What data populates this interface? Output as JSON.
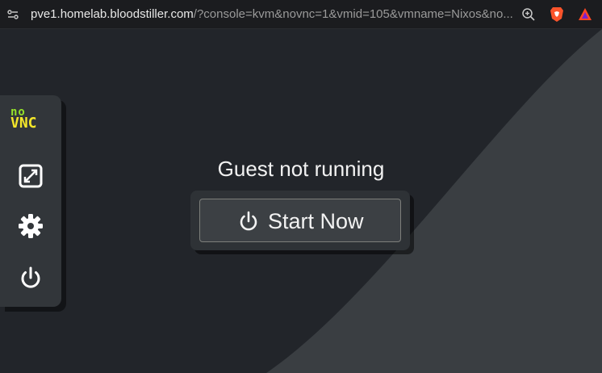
{
  "browser": {
    "url_host": "pve1.homelab.bloodstiller.com",
    "url_rest": "/?console=kvm&novnc=1&vmid=105&vmname=Nixos&no...",
    "icons": [
      "site-info-icon",
      "zoom-icon",
      "brave-shields-icon",
      "brave-rewards-icon"
    ]
  },
  "sidebar": {
    "logo_no": "no",
    "logo_vnc": "VNC",
    "buttons": [
      "fullscreen-icon",
      "settings-gear-icon",
      "power-icon"
    ]
  },
  "main": {
    "status": "Guest not running",
    "start_label": "Start Now"
  },
  "colors": {
    "background": "#22252a",
    "background_curve": "#3a3e42",
    "panel": "#32363a",
    "logo_green": "#94e22a",
    "logo_yellow": "#f3e62a",
    "brave_orange": "#fb542b",
    "rewards_red": "#ff4724"
  }
}
